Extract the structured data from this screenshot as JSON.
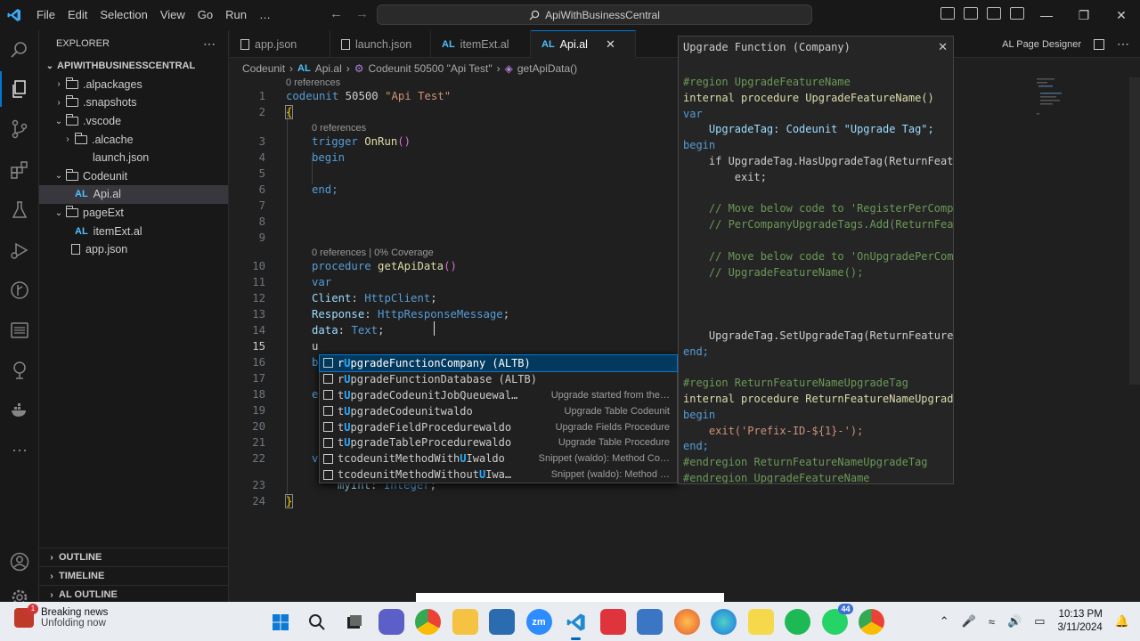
{
  "menu": [
    "File",
    "Edit",
    "Selection",
    "View",
    "Go",
    "Run",
    "…"
  ],
  "search": {
    "text": "ApiWithBusinessCentral"
  },
  "sidebar": {
    "title": "EXPLORER",
    "root": "APIWITHBUSINESSCENTRAL",
    "items": [
      {
        "label": ".alpackages",
        "kind": "folder",
        "level": 1,
        "chev": "›"
      },
      {
        "label": ".snapshots",
        "kind": "folder",
        "level": 1,
        "chev": "›"
      },
      {
        "label": ".vscode",
        "kind": "folder",
        "level": 1,
        "chev": "⌄"
      },
      {
        "label": ".alcache",
        "kind": "folder",
        "level": 2,
        "chev": "›"
      },
      {
        "label": "launch.json",
        "kind": "file",
        "level": 2
      },
      {
        "label": "Codeunit",
        "kind": "folder",
        "level": 1,
        "chev": "⌄"
      },
      {
        "label": "Api.al",
        "kind": "al",
        "level": 2,
        "selected": true
      },
      {
        "label": "pageExt",
        "kind": "folder",
        "level": 1,
        "chev": "⌄"
      },
      {
        "label": "itemExt.al",
        "kind": "al",
        "level": 2
      },
      {
        "label": "app.json",
        "kind": "file",
        "level": 1
      }
    ],
    "sections": [
      "OUTLINE",
      "TIMELINE",
      "AL OUTLINE"
    ]
  },
  "tabs": [
    {
      "label": "app.json",
      "icon": "file"
    },
    {
      "label": "launch.json",
      "icon": "file"
    },
    {
      "label": "itemExt.al",
      "icon": "al"
    },
    {
      "label": "Api.al",
      "icon": "al",
      "active": true
    }
  ],
  "tab_right": {
    "designer": "AL Page Designer"
  },
  "breadcrumb": [
    "Codeunit",
    "Api.al",
    "Codeunit 50500 \"Api Test\"",
    "getApiData()"
  ],
  "breadcrumb_al": "AL",
  "lenses": {
    "l1": "0 references",
    "l3": "0 references",
    "l10": "0 references | 0% Coverage"
  },
  "code": {
    "l1_kw": "codeunit",
    "l1_num": " 50500 ",
    "l1_str": "\"Api Test\"",
    "l2": "{",
    "l3_kw": "trigger",
    "l3_fn": "OnRun",
    "l3_p": "()",
    "l4": "begin",
    "l6": "end;",
    "l10_kw": "procedure",
    "l10_fn": "getApiData",
    "l10_p": "()",
    "l11": "var",
    "l12_v": "Client",
    "l12_t": "HttpClient",
    "l13_v": "Response",
    "l13_t": "HttpResponseMessage",
    "l14_v": "data",
    "l14_t": "Text",
    "l15": "u",
    "l16": "b",
    "l18": "e",
    "l22": "v",
    "l23_v": "myInt",
    "l23_t": "Integer",
    "l24": "}"
  },
  "line_numbers": [
    "1",
    "2",
    "3",
    "4",
    "5",
    "6",
    "7",
    "8",
    "9",
    "10",
    "11",
    "12",
    "13",
    "14",
    "15",
    "16",
    "17",
    "18",
    "19",
    "20",
    "21",
    "22",
    "23",
    "24"
  ],
  "suggestions": [
    {
      "pre": "r",
      "hl": "U",
      "post": "pgradeFunctionCompany (ALTB)",
      "detail": "",
      "selected": true
    },
    {
      "pre": "r",
      "hl": "U",
      "post": "pgradeFunctionDatabase (ALTB)",
      "detail": ""
    },
    {
      "pre": "t",
      "hl": "U",
      "post": "pgradeCodeunitJobQueuewal…",
      "detail": "Upgrade started from the…"
    },
    {
      "pre": "t",
      "hl": "U",
      "post": "pgradeCodeunitwaldo",
      "detail": "Upgrade Table Codeunit"
    },
    {
      "pre": "t",
      "hl": "U",
      "post": "pgradeFieldProcedurewaldo",
      "detail": "Upgrade Fields Procedure"
    },
    {
      "pre": "t",
      "hl": "U",
      "post": "pgradeTableProcedurewaldo",
      "detail": "Upgrade Table Procedure"
    },
    {
      "pre": "tcodeunitMethodWith",
      "hl": "U",
      "post": "Iwaldo",
      "detail": "Snippet (waldo): Method Co…"
    },
    {
      "pre": "tcodeunitMethodWithout",
      "hl": "U",
      "post": "Iwa…",
      "detail": "Snippet (waldo): Method …"
    }
  ],
  "hover": {
    "title": "Upgrade Function (Company)",
    "lines": [
      {
        "t": "#region UpgradeFeatureName",
        "c": "cm"
      },
      {
        "t": "internal procedure UpgradeFeatureName()",
        "c": "mix1"
      },
      {
        "t": "var",
        "c": "kw"
      },
      {
        "t": "    UpgradeTag: Codeunit \"Upgrade Tag\";",
        "c": "mix2"
      },
      {
        "t": "begin",
        "c": "kw"
      },
      {
        "t": "    if UpgradeTag.HasUpgradeTag(ReturnFeatu",
        "c": "pl"
      },
      {
        "t": "        exit;",
        "c": "pl"
      },
      {
        "t": "",
        "c": "pl"
      },
      {
        "t": "    // Move below code to 'RegisterPerCompa",
        "c": "cm"
      },
      {
        "t": "    // PerCompanyUpgradeTags.Add(ReturnFeat",
        "c": "cm"
      },
      {
        "t": "",
        "c": "pl"
      },
      {
        "t": "    // Move below code to 'OnUpgradePerCom",
        "c": "cm"
      },
      {
        "t": "    // UpgradeFeatureName();",
        "c": "cm"
      },
      {
        "t": "",
        "c": "pl"
      },
      {
        "t": "",
        "c": "pl"
      },
      {
        "t": "",
        "c": "pl"
      },
      {
        "t": "    UpgradeTag.SetUpgradeTag(ReturnFeature",
        "c": "pl"
      },
      {
        "t": "end;",
        "c": "kw"
      },
      {
        "t": "",
        "c": "pl"
      },
      {
        "t": "#region ReturnFeatureNameUpgradeTag",
        "c": "cm"
      },
      {
        "t": "internal procedure ReturnFeatureNameUpgrade",
        "c": "mix1"
      },
      {
        "t": "begin",
        "c": "kw"
      },
      {
        "t": "    exit('Prefix-ID-${1}-');",
        "c": "mix3"
      },
      {
        "t": "end;",
        "c": "kw"
      },
      {
        "t": "#endregion ReturnFeatureNameUpgradeTag",
        "c": "cm"
      },
      {
        "t": "#endregion UpgradeFeatureName",
        "c": "cm"
      }
    ]
  },
  "taskbar": {
    "news_title": "Breaking news",
    "news_sub": "Unfolding now",
    "badge_44": "44",
    "time": "10:13 PM",
    "date": "3/11/2024"
  },
  "colors": {
    "accent": "#0078d4",
    "keyword": "#569cd6",
    "function": "#dcdcaa",
    "string": "#ce9178",
    "type": "#4ec9b0",
    "variable": "#9cdcfe",
    "comment": "#6a9955"
  }
}
